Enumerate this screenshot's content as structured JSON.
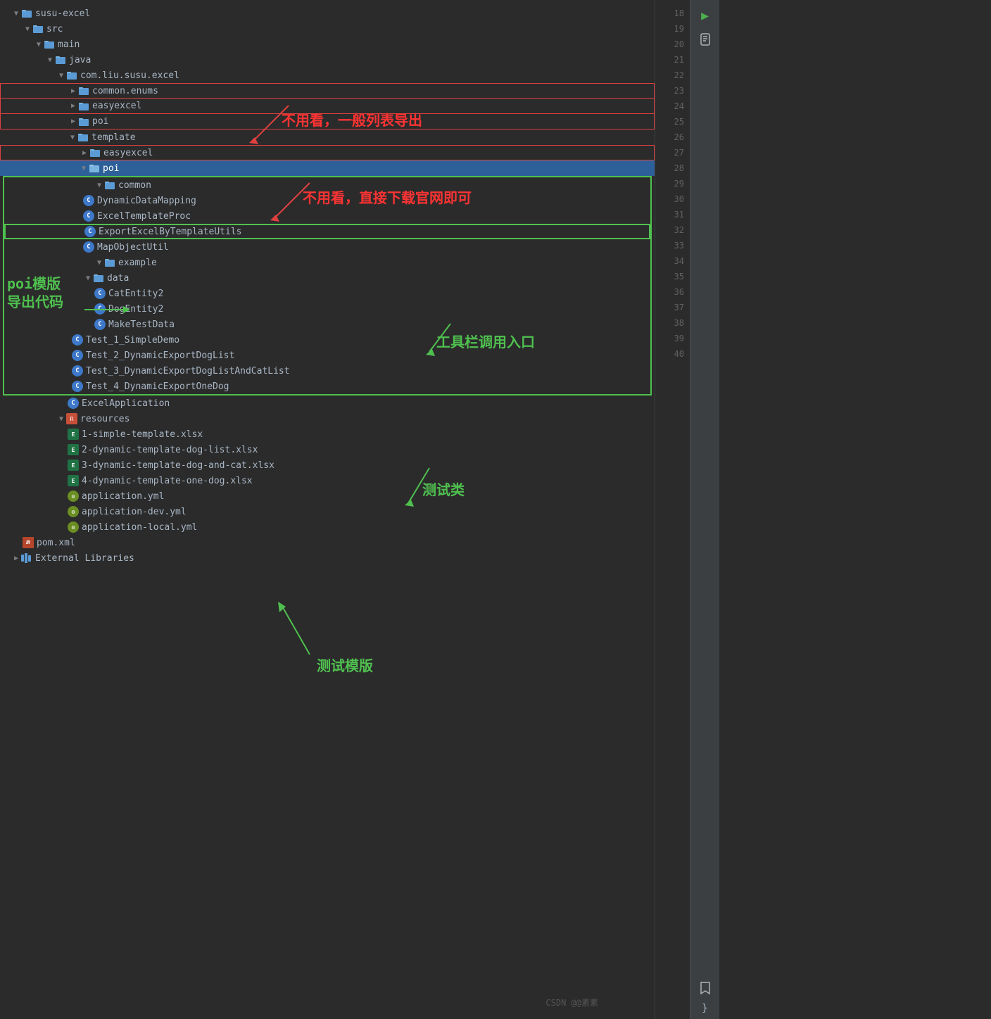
{
  "title": "susu-excel",
  "tree": {
    "root": "susu-excel",
    "items": [
      {
        "id": "susu-excel",
        "label": "susu-excel",
        "type": "folder",
        "level": 0,
        "expanded": true,
        "arrow": "▼"
      },
      {
        "id": "src",
        "label": "src",
        "type": "folder",
        "level": 1,
        "expanded": true,
        "arrow": "▼"
      },
      {
        "id": "main",
        "label": "main",
        "type": "folder",
        "level": 2,
        "expanded": true,
        "arrow": "▼"
      },
      {
        "id": "java",
        "label": "java",
        "type": "folder-src",
        "level": 3,
        "expanded": true,
        "arrow": "▼"
      },
      {
        "id": "com.liu.susu.excel",
        "label": "com.liu.susu.excel",
        "type": "package",
        "level": 4,
        "expanded": true,
        "arrow": "▼"
      },
      {
        "id": "common.enums",
        "label": "common.enums",
        "type": "package",
        "level": 5,
        "expanded": false,
        "arrow": "▶"
      },
      {
        "id": "easyexcel",
        "label": "easyexcel",
        "type": "package",
        "level": 5,
        "expanded": false,
        "arrow": "▶"
      },
      {
        "id": "poi",
        "label": "poi",
        "type": "package",
        "level": 5,
        "expanded": false,
        "arrow": "▶"
      },
      {
        "id": "template",
        "label": "template",
        "type": "package",
        "level": 5,
        "expanded": true,
        "arrow": "▼"
      },
      {
        "id": "template-easyexcel",
        "label": "easyexcel",
        "type": "package",
        "level": 6,
        "expanded": false,
        "arrow": "▶"
      },
      {
        "id": "template-poi",
        "label": "poi",
        "type": "package-selected",
        "level": 6,
        "expanded": true,
        "arrow": "▼",
        "selected": true
      },
      {
        "id": "common",
        "label": "common",
        "type": "package",
        "level": 7,
        "expanded": true,
        "arrow": "▼"
      },
      {
        "id": "DynamicDataMapping",
        "label": "DynamicDataMapping",
        "type": "class",
        "level": 8
      },
      {
        "id": "ExcelTemplateProc",
        "label": "ExcelTemplateProc",
        "type": "class",
        "level": 8
      },
      {
        "id": "ExportExcelByTemplateUtils",
        "label": "ExportExcelByTemplateUtils",
        "type": "class-highlight",
        "level": 8
      },
      {
        "id": "MapObjectUtil",
        "label": "MapObjectUtil",
        "type": "class",
        "level": 8
      },
      {
        "id": "example",
        "label": "example",
        "type": "package",
        "level": 7,
        "expanded": true,
        "arrow": "▼"
      },
      {
        "id": "data",
        "label": "data",
        "type": "package",
        "level": 8,
        "expanded": true,
        "arrow": "▼"
      },
      {
        "id": "CatEntity2",
        "label": "CatEntity2",
        "type": "class",
        "level": 9
      },
      {
        "id": "DogEntity2",
        "label": "DogEntity2",
        "type": "class",
        "level": 9
      },
      {
        "id": "MakeTestData",
        "label": "MakeTestData",
        "type": "class",
        "level": 9
      },
      {
        "id": "Test_1_SimpleDemo",
        "label": "Test_1_SimpleDemo",
        "type": "class",
        "level": 8
      },
      {
        "id": "Test_2_DynamicExportDogList",
        "label": "Test_2_DynamicExportDogList",
        "type": "class",
        "level": 8
      },
      {
        "id": "Test_3_DynamicExportDogListAndCatList",
        "label": "Test_3_DynamicExportDogListAndCatList",
        "type": "class",
        "level": 8
      },
      {
        "id": "Test_4_DynamicExportOneDog",
        "label": "Test_4_DynamicExportOneDog",
        "type": "class",
        "level": 8
      },
      {
        "id": "ExcelApplication",
        "label": "ExcelApplication",
        "type": "class",
        "level": 5
      },
      {
        "id": "resources",
        "label": "resources",
        "type": "resources",
        "level": 4,
        "expanded": true,
        "arrow": "▼"
      },
      {
        "id": "1-simple-template.xlsx",
        "label": "1-simple-template.xlsx",
        "type": "excel",
        "level": 5
      },
      {
        "id": "2-dynamic-template-dog-list.xlsx",
        "label": "2-dynamic-template-dog-list.xlsx",
        "type": "excel",
        "level": 5
      },
      {
        "id": "3-dynamic-template-dog-and-cat.xlsx",
        "label": "3-dynamic-template-dog-and-cat.xlsx",
        "type": "excel",
        "level": 5
      },
      {
        "id": "4-dynamic-template-one-dog.xlsx",
        "label": "4-dynamic-template-one-dog.xlsx",
        "type": "excel",
        "level": 5
      },
      {
        "id": "application.yml",
        "label": "application.yml",
        "type": "yaml",
        "level": 5
      },
      {
        "id": "application-dev.yml",
        "label": "application-dev.yml",
        "type": "yaml",
        "level": 5
      },
      {
        "id": "application-local.yml",
        "label": "application-local.yml",
        "type": "yaml",
        "level": 5
      },
      {
        "id": "pom.xml",
        "label": "pom.xml",
        "type": "maven",
        "level": 1
      },
      {
        "id": "External Libraries",
        "label": "External Libraries",
        "type": "ext-lib",
        "level": 0,
        "arrow": "▶"
      }
    ]
  },
  "annotations": {
    "red1_text": "不用看，一般列表导出",
    "red2_text": "不用看，直接下载官网即可",
    "green1_text": "poi模版\n导出代码",
    "green2_text": "工具栏调用入口",
    "green3_text": "测试类",
    "green4_text": "测试模版"
  },
  "line_numbers": [
    18,
    19,
    20,
    21,
    22,
    23,
    24,
    25,
    26,
    27,
    28,
    29,
    30,
    31,
    32,
    33,
    34,
    35,
    36,
    37,
    38,
    39,
    40
  ],
  "toolbar": {
    "run_icon": "▶",
    "debug_icon": "🔧"
  },
  "watermark": "CSDN @@素素"
}
